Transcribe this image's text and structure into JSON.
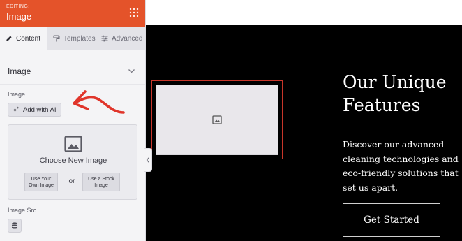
{
  "editor": {
    "header": {
      "editing_label": "EDITING:",
      "title": "Image"
    },
    "tabs": [
      {
        "label": "Content",
        "icon": "pencil-icon",
        "active": true
      },
      {
        "label": "Templates",
        "icon": "paint-roller-icon",
        "active": false
      },
      {
        "label": "Advanced",
        "icon": "sliders-icon",
        "active": false
      }
    ],
    "section": {
      "title": "Image",
      "expanded": true
    },
    "image_field": {
      "label": "Image",
      "ai_button_label": "Add with AI",
      "dropzone_title": "Choose New Image",
      "own_image_button": "Use Your Own Image",
      "or_text": "or",
      "stock_image_button": "Use a Stock Image"
    },
    "image_src": {
      "label": "Image Src",
      "icon": "database-icon"
    }
  },
  "preview": {
    "headline": "Our Unique Features",
    "description": "Discover our advanced cleaning technologies and eco-friendly solutions that set us apart.",
    "cta_label": "Get Started"
  },
  "colors": {
    "header_bg": "#e4532a",
    "annotation_arrow": "#e0352b",
    "selection_outline": "#c8362a",
    "preview_bg": "#000000"
  }
}
